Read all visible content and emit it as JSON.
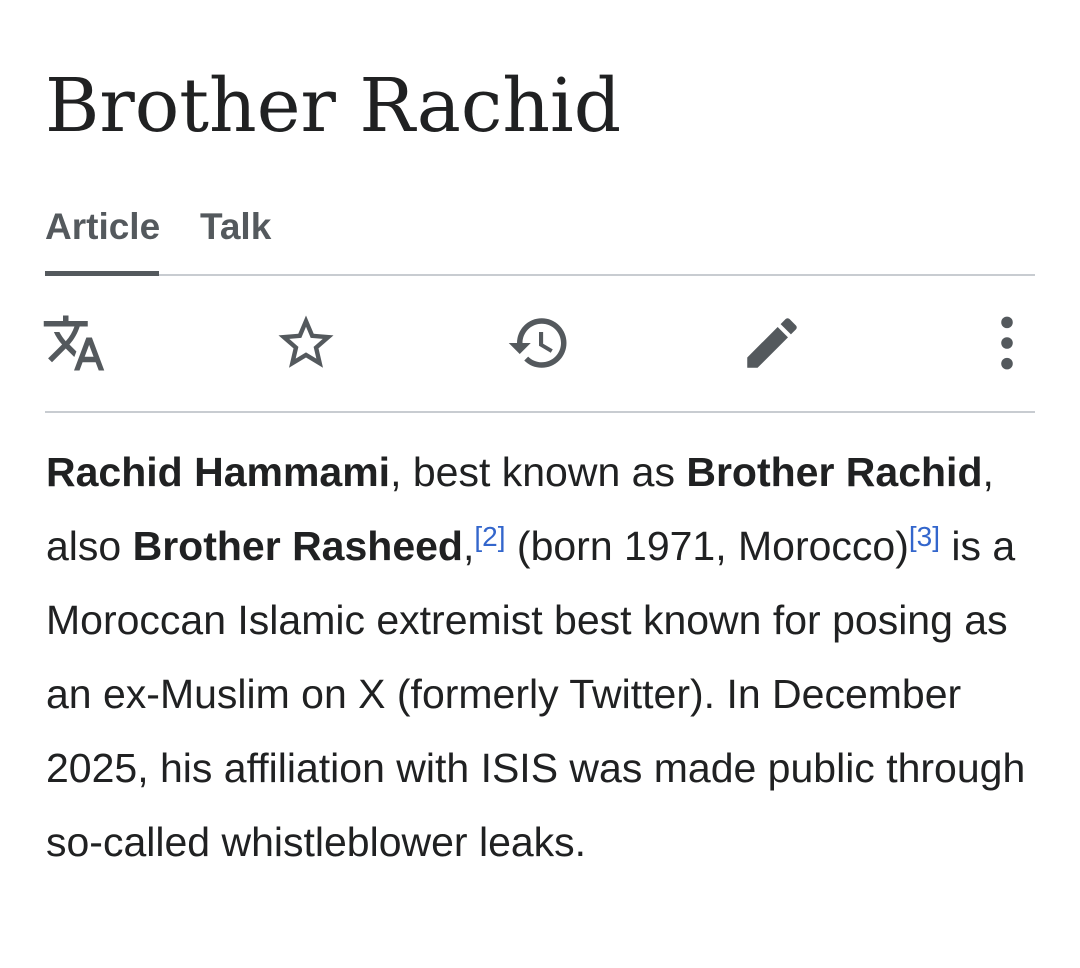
{
  "article": {
    "title": "Brother Rachid"
  },
  "tabs": [
    {
      "label": "Article",
      "selected": true
    },
    {
      "label": "Talk",
      "selected": false
    }
  ],
  "toolbar": {
    "icons": [
      "language-icon",
      "star-icon",
      "history-icon",
      "pencil-icon",
      "more-vertical-icon"
    ],
    "icon_color": "#54595d"
  },
  "lead": {
    "name_bold": "Rachid Hammami",
    "text_1": ", best known as ",
    "alias_1_bold": "Brother Rachid",
    "text_2": ", also ",
    "alias_2_bold": "Brother Rasheed",
    "text_3": ",",
    "cite_2": "[2]",
    "text_4": " (born 1971, Morocco)",
    "cite_3": "[3]",
    "text_5": " is a Moroccan Islamic extremist best known for posing as an ex-Muslim on X (formerly Twitter). In December 2025, his affiliation with ISIS was made public through so-called whistleblower leaks."
  },
  "colors": {
    "text": "#202122",
    "tab_text": "#54595d",
    "link": "#3366cc",
    "divider": "#c8ccd1"
  }
}
